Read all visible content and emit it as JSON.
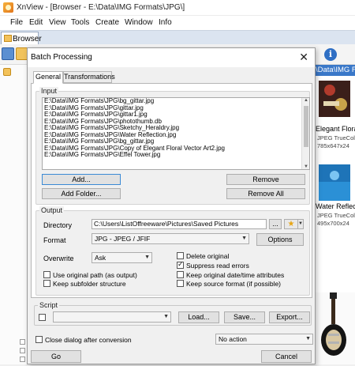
{
  "app": {
    "title": "XnView - [Browser - E:\\Data\\IMG Formats\\JPG\\]",
    "menu": [
      "File",
      "Edit",
      "View",
      "Tools",
      "Create",
      "Window",
      "Info"
    ],
    "browser_tab_label": "Browser",
    "path_bar": "\\Data\\IMG Formats\\JPG\\",
    "thumbnails": [
      {
        "name": "Elegant Flora",
        "meta1": "JPEG TrueColor",
        "meta2": "785x647x24"
      },
      {
        "name": "Water Reflect",
        "meta1": "JPEG TrueColor",
        "meta2": "495x700x24"
      }
    ]
  },
  "dialog": {
    "title": "Batch Processing",
    "close_glyph": "✕",
    "tabs": [
      "General",
      "Transformations"
    ],
    "input": {
      "label": "Input",
      "files": [
        "E:\\Data\\IMG Formats\\JPG\\bg_gittar.jpg",
        "E:\\Data\\IMG Formats\\JPG\\gittar.jpg",
        "E:\\Data\\IMG Formats\\JPG\\gittar1.jpg",
        "E:\\Data\\IMG Formats\\JPG\\photothumb.db",
        "E:\\Data\\IMG Formats\\JPG\\Sketchy_Heraldry.jpg",
        "E:\\Data\\IMG Formats\\JPG\\Water Reflection.jpg",
        "E:\\Data\\IMG Formats\\JPG\\bg_gittar.jpg",
        "E:\\Data\\IMG Formats\\JPG\\Copy of Elegant Floral Vector Art2.jpg",
        "E:\\Data\\IMG Formats\\JPG\\Effel Tower.jpg"
      ],
      "add": "Add...",
      "remove": "Remove",
      "add_folder": "Add Folder...",
      "remove_all": "Remove All"
    },
    "output": {
      "label": "Output",
      "directory_label": "Directory",
      "directory_value": "C:\\Users\\ListOffreeware\\Pictures\\Saved Pictures",
      "browse": "...",
      "format_label": "Format",
      "format_value": "JPG - JPEG / JFIF",
      "options": "Options",
      "overwrite_label": "Overwrite",
      "overwrite_value": "Ask",
      "checks": {
        "delete_original": {
          "label": "Delete original",
          "checked": false
        },
        "suppress_read_errors": {
          "label": "Suppress read errors",
          "checked": true
        },
        "use_original_path": {
          "label": "Use original path (as output)",
          "checked": false
        },
        "keep_date_time": {
          "label": "Keep original date/time attributes",
          "checked": false
        },
        "keep_subfolder": {
          "label": "Keep subfolder structure",
          "checked": false
        },
        "keep_source_format": {
          "label": "Keep source format (if possible)",
          "checked": false
        }
      }
    },
    "script": {
      "label": "Script",
      "load": "Load...",
      "save": "Save...",
      "export": "Export..."
    },
    "close_after_label": "Close dialog after conversion",
    "action_value": "No action",
    "go": "Go",
    "cancel": "Cancel"
  }
}
